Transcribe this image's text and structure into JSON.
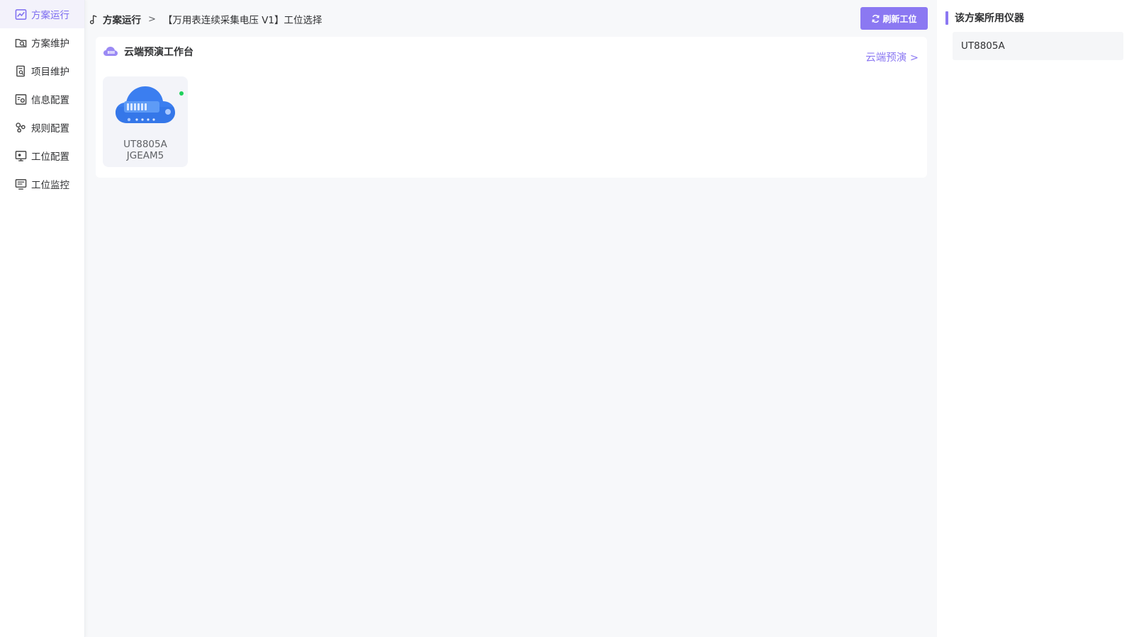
{
  "sidebar": {
    "items": [
      {
        "label": "方案运行",
        "icon": "chart-line-icon",
        "active": true
      },
      {
        "label": "方案维护",
        "icon": "folder-search-icon",
        "active": false
      },
      {
        "label": "项目维护",
        "icon": "document-search-icon",
        "active": false
      },
      {
        "label": "信息配置",
        "icon": "info-settings-icon",
        "active": false
      },
      {
        "label": "规则配置",
        "icon": "nodes-icon",
        "active": false
      },
      {
        "label": "工位配置",
        "icon": "monitor-settings-icon",
        "active": false
      },
      {
        "label": "工位监控",
        "icon": "monitor-list-icon",
        "active": false
      }
    ]
  },
  "breadcrumb": {
    "root": "方案运行",
    "separator": ">",
    "current": "【万用表连续采集电压 V1】工位选择"
  },
  "toolbar": {
    "refresh_label": "刷新工位"
  },
  "panel": {
    "title": "云端预演工作台",
    "link_label": "云端预演 >",
    "stations": [
      {
        "line1": "UT8805A",
        "line2": "JGEAM5",
        "status": "online"
      }
    ]
  },
  "right_panel": {
    "title": "该方案所用仪器",
    "instruments": [
      "UT8805A"
    ]
  },
  "colors": {
    "accent": "#8b78f2",
    "active_bg": "#f3f2fb",
    "online": "#1fd15b",
    "device_blue": "#3b7ef0"
  }
}
